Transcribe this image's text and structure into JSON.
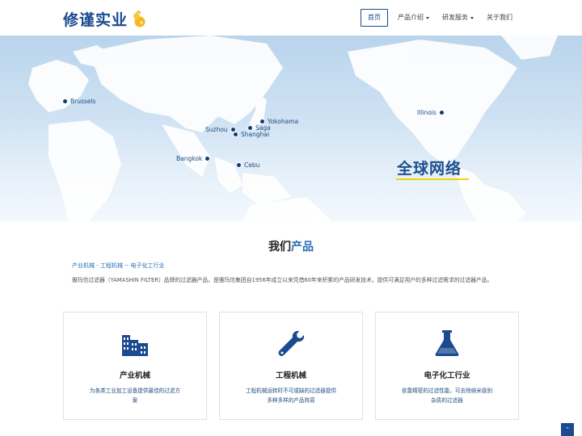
{
  "header": {
    "logo_text": "修谨实业",
    "nav": [
      {
        "label": "首页"
      },
      {
        "label": "产品介绍"
      },
      {
        "label": "研发服务"
      },
      {
        "label": "关于我们"
      }
    ]
  },
  "banner": {
    "title": "全球网络",
    "cities": [
      "Brussels",
      "Suzhou",
      "Saga",
      "Yokohama",
      "Shanghai",
      "Bangkok",
      "Cebu",
      "Illinois"
    ]
  },
  "products": {
    "heading_main": "我们",
    "heading_accent": "产品",
    "breadcrumb": "产业机械 - 工程机械 -- 电子化工行业",
    "intro": "雅玛信过滤器（YAMASHIN FILTER）品牌的过滤器产品，是雅玛信集团自1956年成立以来凭借60年来积累的产品研发技术，提供可满足用户的多种过滤需求的过滤器产品。",
    "cards": [
      {
        "title": "产业机械",
        "desc": "为各类工业加工设备提供最佳的过滤方案",
        "icon": "factory-icon"
      },
      {
        "title": "工程机械",
        "desc": "工程机械运转时不可或缺的过滤器提供多种多样的产品阵容",
        "icon": "wrench-icon"
      },
      {
        "title": "电子化工行业",
        "desc": "依靠精密的过滤性能，可去除纳米级别杂质的过滤器",
        "icon": "flask-icon"
      }
    ]
  },
  "scroll_top_glyph": "⌃",
  "colors": {
    "brand": "#1a4a8f",
    "accent": "#2a6db3",
    "highlight": "#f1d300"
  }
}
